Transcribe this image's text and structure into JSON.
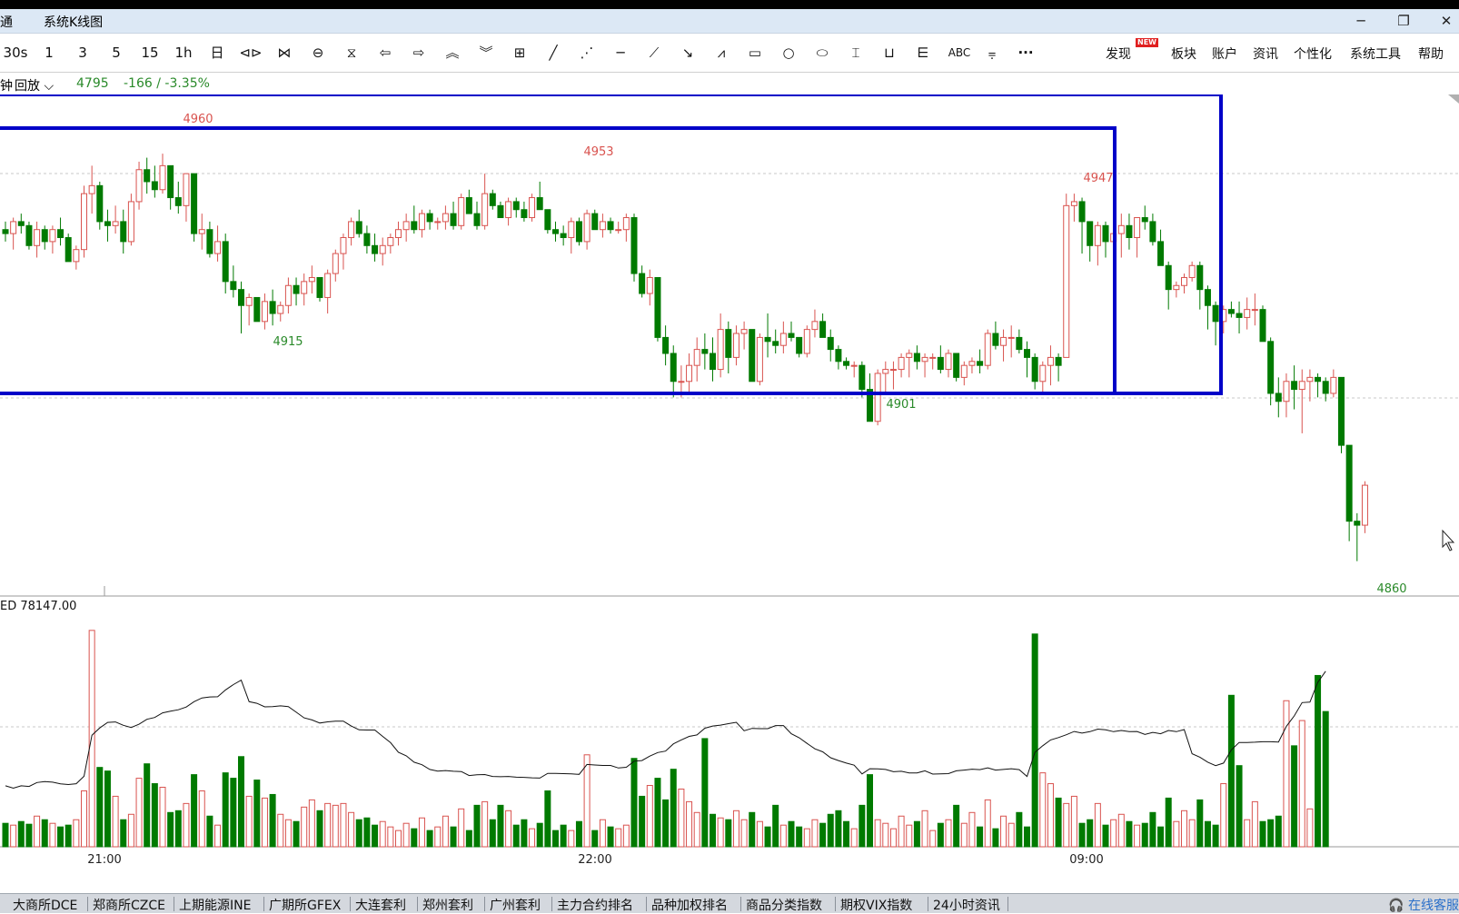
{
  "window": {
    "title_partial": "通",
    "title": "系统K线图",
    "controls": [
      "─",
      "❐",
      "✕"
    ]
  },
  "toolbar": {
    "periods": [
      "30s",
      "1",
      "3",
      "5",
      "15",
      "1h",
      "日"
    ],
    "tool_icons": [
      "step-left-icon",
      "step-right-icon",
      "zoom-v-icon",
      "zoom-h-icon",
      "arrow-left-icon",
      "arrow-right-icon",
      "chevron-up-icon",
      "chevron-down-icon",
      "layout-icon",
      "line-icon",
      "ray-icon",
      "hline-icon",
      "segment-icon",
      "arrow-line-icon",
      "wave-icon",
      "rectangle-icon",
      "circle-icon",
      "ellipse-icon",
      "fib-icon",
      "ruler-icon",
      "cycle-icon",
      "text-icon",
      "toolset-icon",
      "more-icon"
    ],
    "menu": {
      "discover": "发现",
      "new_badge": "NEW",
      "sector": "板块",
      "account": "账户",
      "news": "资讯",
      "personalize": "个性化",
      "system_tools": "系统工具",
      "help": "帮助"
    }
  },
  "info": {
    "period_partial": "钟",
    "replay_label": "回放",
    "price": "4795",
    "change": "-166 / -3.35%"
  },
  "chart_data": {
    "type": "candlestick",
    "price_ylim": [
      4852,
      4968
    ],
    "annotations": [
      {
        "label": "4960",
        "kind": "high"
      },
      {
        "label": "4953",
        "kind": "high"
      },
      {
        "label": "4947",
        "kind": "high"
      },
      {
        "label": "4915",
        "kind": "low"
      },
      {
        "label": "4901",
        "kind": "low"
      },
      {
        "label": "4860",
        "kind": "low"
      }
    ],
    "volume_label": "ED 78147.00",
    "x_labels": [
      "21:00",
      "22:00",
      "09:00"
    ],
    "up_color": "#d9534f",
    "down_color": "#007a00",
    "candles": [
      [
        4941,
        4943,
        4938,
        4940
      ],
      [
        4940,
        4944,
        4936,
        4943
      ],
      [
        4943,
        4945,
        4940,
        4942
      ],
      [
        4942,
        4943,
        4936,
        4937
      ],
      [
        4937,
        4943,
        4934,
        4941
      ],
      [
        4941,
        4942,
        4936,
        4938
      ],
      [
        4938,
        4942,
        4935,
        4941
      ],
      [
        4941,
        4944,
        4937,
        4939
      ],
      [
        4939,
        4940,
        4933,
        4933
      ],
      [
        4933,
        4937,
        4931,
        4936
      ],
      [
        4936,
        4952,
        4934,
        4950
      ],
      [
        4950,
        4957,
        4945,
        4952
      ],
      [
        4952,
        4953,
        4941,
        4943
      ],
      [
        4943,
        4946,
        4938,
        4942
      ],
      [
        4942,
        4947,
        4940,
        4943
      ],
      [
        4943,
        4946,
        4935,
        4938
      ],
      [
        4938,
        4950,
        4937,
        4948
      ],
      [
        4948,
        4958,
        4946,
        4956
      ],
      [
        4956,
        4959,
        4950,
        4953
      ],
      [
        4953,
        4957,
        4949,
        4951
      ],
      [
        4951,
        4960,
        4950,
        4957
      ],
      [
        4957,
        4957,
        4946,
        4949
      ],
      [
        4949,
        4953,
        4945,
        4947
      ],
      [
        4947,
        4955,
        4943,
        4955
      ],
      [
        4955,
        4955,
        4938,
        4940
      ],
      [
        4940,
        4945,
        4936,
        4941
      ],
      [
        4941,
        4943,
        4934,
        4935
      ],
      [
        4935,
        4942,
        4933,
        4938
      ],
      [
        4938,
        4940,
        4925,
        4928
      ],
      [
        4928,
        4932,
        4924,
        4926
      ],
      [
        4926,
        4928,
        4915,
        4922
      ],
      [
        4922,
        4925,
        4917,
        4924
      ],
      [
        4924,
        4924,
        4918,
        4918
      ],
      [
        4918,
        4925,
        4916,
        4923
      ],
      [
        4923,
        4926,
        4917,
        4920
      ],
      [
        4920,
        4923,
        4918,
        4922
      ],
      [
        4922,
        4929,
        4920,
        4927
      ],
      [
        4927,
        4929,
        4922,
        4925
      ],
      [
        4925,
        4930,
        4922,
        4928
      ],
      [
        4928,
        4932,
        4925,
        4929
      ],
      [
        4929,
        4929,
        4923,
        4924
      ],
      [
        4924,
        4931,
        4920,
        4930
      ],
      [
        4930,
        4936,
        4928,
        4935
      ],
      [
        4935,
        4940,
        4931,
        4939
      ],
      [
        4939,
        4944,
        4937,
        4943
      ],
      [
        4943,
        4946,
        4939,
        4940
      ],
      [
        4940,
        4942,
        4935,
        4937
      ],
      [
        4937,
        4940,
        4933,
        4935
      ],
      [
        4935,
        4939,
        4932,
        4937
      ],
      [
        4937,
        4940,
        4935,
        4939
      ],
      [
        4939,
        4943,
        4937,
        4941
      ],
      [
        4941,
        4945,
        4938,
        4943
      ],
      [
        4943,
        4947,
        4940,
        4941
      ],
      [
        4941,
        4946,
        4939,
        4945
      ],
      [
        4945,
        4946,
        4941,
        4943
      ],
      [
        4943,
        4944,
        4941,
        4943
      ],
      [
        4943,
        4947,
        4941,
        4945
      ],
      [
        4945,
        4948,
        4941,
        4942
      ],
      [
        4942,
        4950,
        4941,
        4949
      ],
      [
        4949,
        4951,
        4945,
        4945
      ],
      [
        4945,
        4948,
        4941,
        4942
      ],
      [
        4942,
        4955,
        4941,
        4950
      ],
      [
        4950,
        4951,
        4946,
        4947
      ],
      [
        4947,
        4948,
        4944,
        4944
      ],
      [
        4944,
        4949,
        4942,
        4948
      ],
      [
        4948,
        4949,
        4944,
        4946
      ],
      [
        4946,
        4948,
        4943,
        4944
      ],
      [
        4944,
        4950,
        4943,
        4949
      ],
      [
        4949,
        4953,
        4946,
        4946
      ],
      [
        4946,
        4946,
        4940,
        4941
      ],
      [
        4941,
        4943,
        4938,
        4940
      ],
      [
        4940,
        4942,
        4937,
        4939
      ],
      [
        4939,
        4944,
        4935,
        4943
      ],
      [
        4943,
        4944,
        4937,
        4938
      ],
      [
        4938,
        4946,
        4936,
        4945
      ],
      [
        4945,
        4946,
        4941,
        4941
      ],
      [
        4941,
        4945,
        4939,
        4943
      ],
      [
        4943,
        4944,
        4940,
        4941
      ],
      [
        4941,
        4943,
        4940,
        4941
      ],
      [
        4941,
        4945,
        4938,
        4944
      ],
      [
        4944,
        4945,
        4928,
        4930
      ],
      [
        4930,
        4932,
        4924,
        4925
      ],
      [
        4925,
        4931,
        4922,
        4929
      ],
      [
        4929,
        4929,
        4913,
        4914
      ],
      [
        4914,
        4917,
        4907,
        4910
      ],
      [
        4910,
        4912,
        4899,
        4903
      ],
      [
        4903,
        4907,
        4899,
        4903
      ],
      [
        4903,
        4910,
        4900,
        4907
      ],
      [
        4907,
        4914,
        4903,
        4911
      ],
      [
        4911,
        4915,
        4906,
        4910
      ],
      [
        4910,
        4914,
        4903,
        4906
      ],
      [
        4906,
        4920,
        4904,
        4916
      ],
      [
        4916,
        4918,
        4905,
        4909
      ],
      [
        4909,
        4917,
        4907,
        4915
      ],
      [
        4915,
        4918,
        4911,
        4916
      ],
      [
        4916,
        4916,
        4903,
        4903
      ],
      [
        4903,
        4915,
        4902,
        4914
      ],
      [
        4914,
        4920,
        4909,
        4913
      ],
      [
        4913,
        4916,
        4910,
        4912
      ],
      [
        4912,
        4918,
        4910,
        4915
      ],
      [
        4915,
        4918,
        4913,
        4914
      ],
      [
        4914,
        4914,
        4909,
        4910
      ],
      [
        4910,
        4917,
        4909,
        4916
      ],
      [
        4916,
        4921,
        4914,
        4918
      ],
      [
        4918,
        4920,
        4914,
        4914
      ],
      [
        4914,
        4916,
        4908,
        4911
      ],
      [
        4911,
        4912,
        4906,
        4908
      ],
      [
        4908,
        4909,
        4906,
        4907
      ],
      [
        4907,
        4908,
        4904,
        4907
      ],
      [
        4907,
        4908,
        4899,
        4901
      ],
      [
        4901,
        4905,
        4896,
        4893
      ],
      [
        4893,
        4906,
        4892,
        4905
      ],
      [
        4905,
        4908,
        4900,
        4906
      ],
      [
        4906,
        4908,
        4901,
        4906
      ],
      [
        4906,
        4910,
        4904,
        4909
      ],
      [
        4909,
        4911,
        4904,
        4910
      ],
      [
        4910,
        4912,
        4906,
        4908
      ],
      [
        4908,
        4910,
        4904,
        4909
      ],
      [
        4909,
        4910,
        4906,
        4909
      ],
      [
        4909,
        4912,
        4905,
        4906
      ],
      [
        4906,
        4911,
        4904,
        4910
      ],
      [
        4910,
        4910,
        4903,
        4904
      ],
      [
        4904,
        4908,
        4902,
        4907
      ],
      [
        4907,
        4909,
        4905,
        4908
      ],
      [
        4908,
        4911,
        4905,
        4907
      ],
      [
        4907,
        4916,
        4906,
        4915
      ],
      [
        4915,
        4918,
        4911,
        4912
      ],
      [
        4912,
        4916,
        4908,
        4914
      ],
      [
        4914,
        4917,
        4909,
        4914
      ],
      [
        4914,
        4916,
        4910,
        4911
      ],
      [
        4911,
        4913,
        4904,
        4909
      ],
      [
        4909,
        4910,
        4901,
        4903
      ],
      [
        4903,
        4908,
        4900,
        4907
      ],
      [
        4907,
        4912,
        4902,
        4909
      ],
      [
        4909,
        4910,
        4903,
        4907
      ],
      [
        4909,
        4950,
        4938,
        4947
      ],
      [
        4947,
        4950,
        4943,
        4948
      ],
      [
        4948,
        4949,
        4935,
        4943
      ],
      [
        4943,
        4943,
        4933,
        4937
      ],
      [
        4937,
        4943,
        4932,
        4942
      ],
      [
        4942,
        4943,
        4934,
        4938
      ],
      [
        4938,
        4942,
        4934,
        4940
      ],
      [
        4940,
        4945,
        4934,
        4942
      ],
      [
        4942,
        4945,
        4936,
        4939
      ],
      [
        4939,
        4944,
        4934,
        4944
      ],
      [
        4944,
        4947,
        4941,
        4943
      ],
      [
        4943,
        4945,
        4937,
        4938
      ],
      [
        4938,
        4941,
        4932,
        4932
      ],
      [
        4932,
        4933,
        4921,
        4926
      ],
      [
        4926,
        4928,
        4924,
        4927
      ],
      [
        4927,
        4930,
        4925,
        4929
      ],
      [
        4929,
        4933,
        4928,
        4932
      ],
      [
        4932,
        4933,
        4921,
        4926
      ],
      [
        4926,
        4927,
        4916,
        4922
      ],
      [
        4922,
        4923,
        4912,
        4918
      ],
      [
        4918,
        4922,
        4915,
        4921
      ],
      [
        4921,
        4923,
        4919,
        4920
      ],
      [
        4920,
        4923,
        4915,
        4919
      ],
      [
        4919,
        4924,
        4916,
        4921
      ],
      [
        4921,
        4925,
        4917,
        4921
      ],
      [
        4921,
        4922,
        4913,
        4913
      ],
      [
        4913,
        4914,
        4897,
        4900
      ],
      [
        4900,
        4904,
        4894,
        4898
      ],
      [
        4898,
        4905,
        4894,
        4903
      ],
      [
        4903,
        4907,
        4896,
        4901
      ],
      [
        4901,
        4906,
        4890,
        4903
      ],
      [
        4903,
        4906,
        4898,
        4904
      ],
      [
        4904,
        4905,
        4899,
        4903
      ],
      [
        4903,
        4904,
        4898,
        4900
      ],
      [
        4900,
        4906,
        4899,
        4904
      ],
      [
        4904,
        4904,
        4885,
        4887
      ],
      [
        4887,
        4887,
        4863,
        4868
      ],
      [
        4868,
        4870,
        4858,
        4867
      ],
      [
        4867,
        4878,
        4865,
        4877
      ]
    ],
    "volume_scale_max": 260,
    "volumes": [
      26,
      24,
      28,
      25,
      34,
      30,
      26,
      22,
      24,
      30,
      62,
      240,
      88,
      84,
      56,
      30,
      36,
      76,
      92,
      70,
      66,
      38,
      40,
      48,
      80,
      62,
      34,
      24,
      82,
      76,
      100,
      56,
      74,
      54,
      58,
      36,
      30,
      28,
      44,
      52,
      40,
      48,
      46,
      48,
      38,
      30,
      32,
      24,
      28,
      22,
      18,
      26,
      20,
      32,
      18,
      22,
      34,
      22,
      42,
      18,
      46,
      50,
      30,
      46,
      40,
      24,
      30,
      20,
      26,
      62,
      18,
      24,
      18,
      28,
      102,
      18,
      30,
      22,
      20,
      24,
      98,
      56,
      68,
      76,
      52,
      86,
      64,
      50,
      38,
      120,
      36,
      32,
      30,
      40,
      30,
      38,
      28,
      22,
      46,
      24,
      28,
      22,
      20,
      30,
      26,
      36,
      40,
      28,
      20,
      46,
      80,
      30,
      26,
      20,
      34,
      24,
      28,
      40,
      18,
      26,
      30,
      46,
      26,
      38,
      22,
      52,
      20,
      34,
      26,
      38,
      22,
      236,
      82,
      70,
      54,
      48,
      56,
      26,
      30,
      48,
      24,
      30,
      36,
      28,
      24,
      26,
      38,
      22,
      54,
      28,
      40,
      30,
      52,
      28,
      24,
      70,
      168,
      90,
      30,
      50,
      28,
      30,
      34,
      162,
      112,
      140,
      42,
      190,
      150
    ]
  },
  "bottom_tabs": [
    "大商所DCE",
    "郑商所CZCE",
    "上期能源INE",
    "广期所GFEX",
    "大连套利",
    "郑州套利",
    "广州套利",
    "主力合约排名",
    "品种加权排名",
    "商品分类指数",
    "期权VIX指数",
    "24小时资讯"
  ],
  "service_label": "在线客服"
}
